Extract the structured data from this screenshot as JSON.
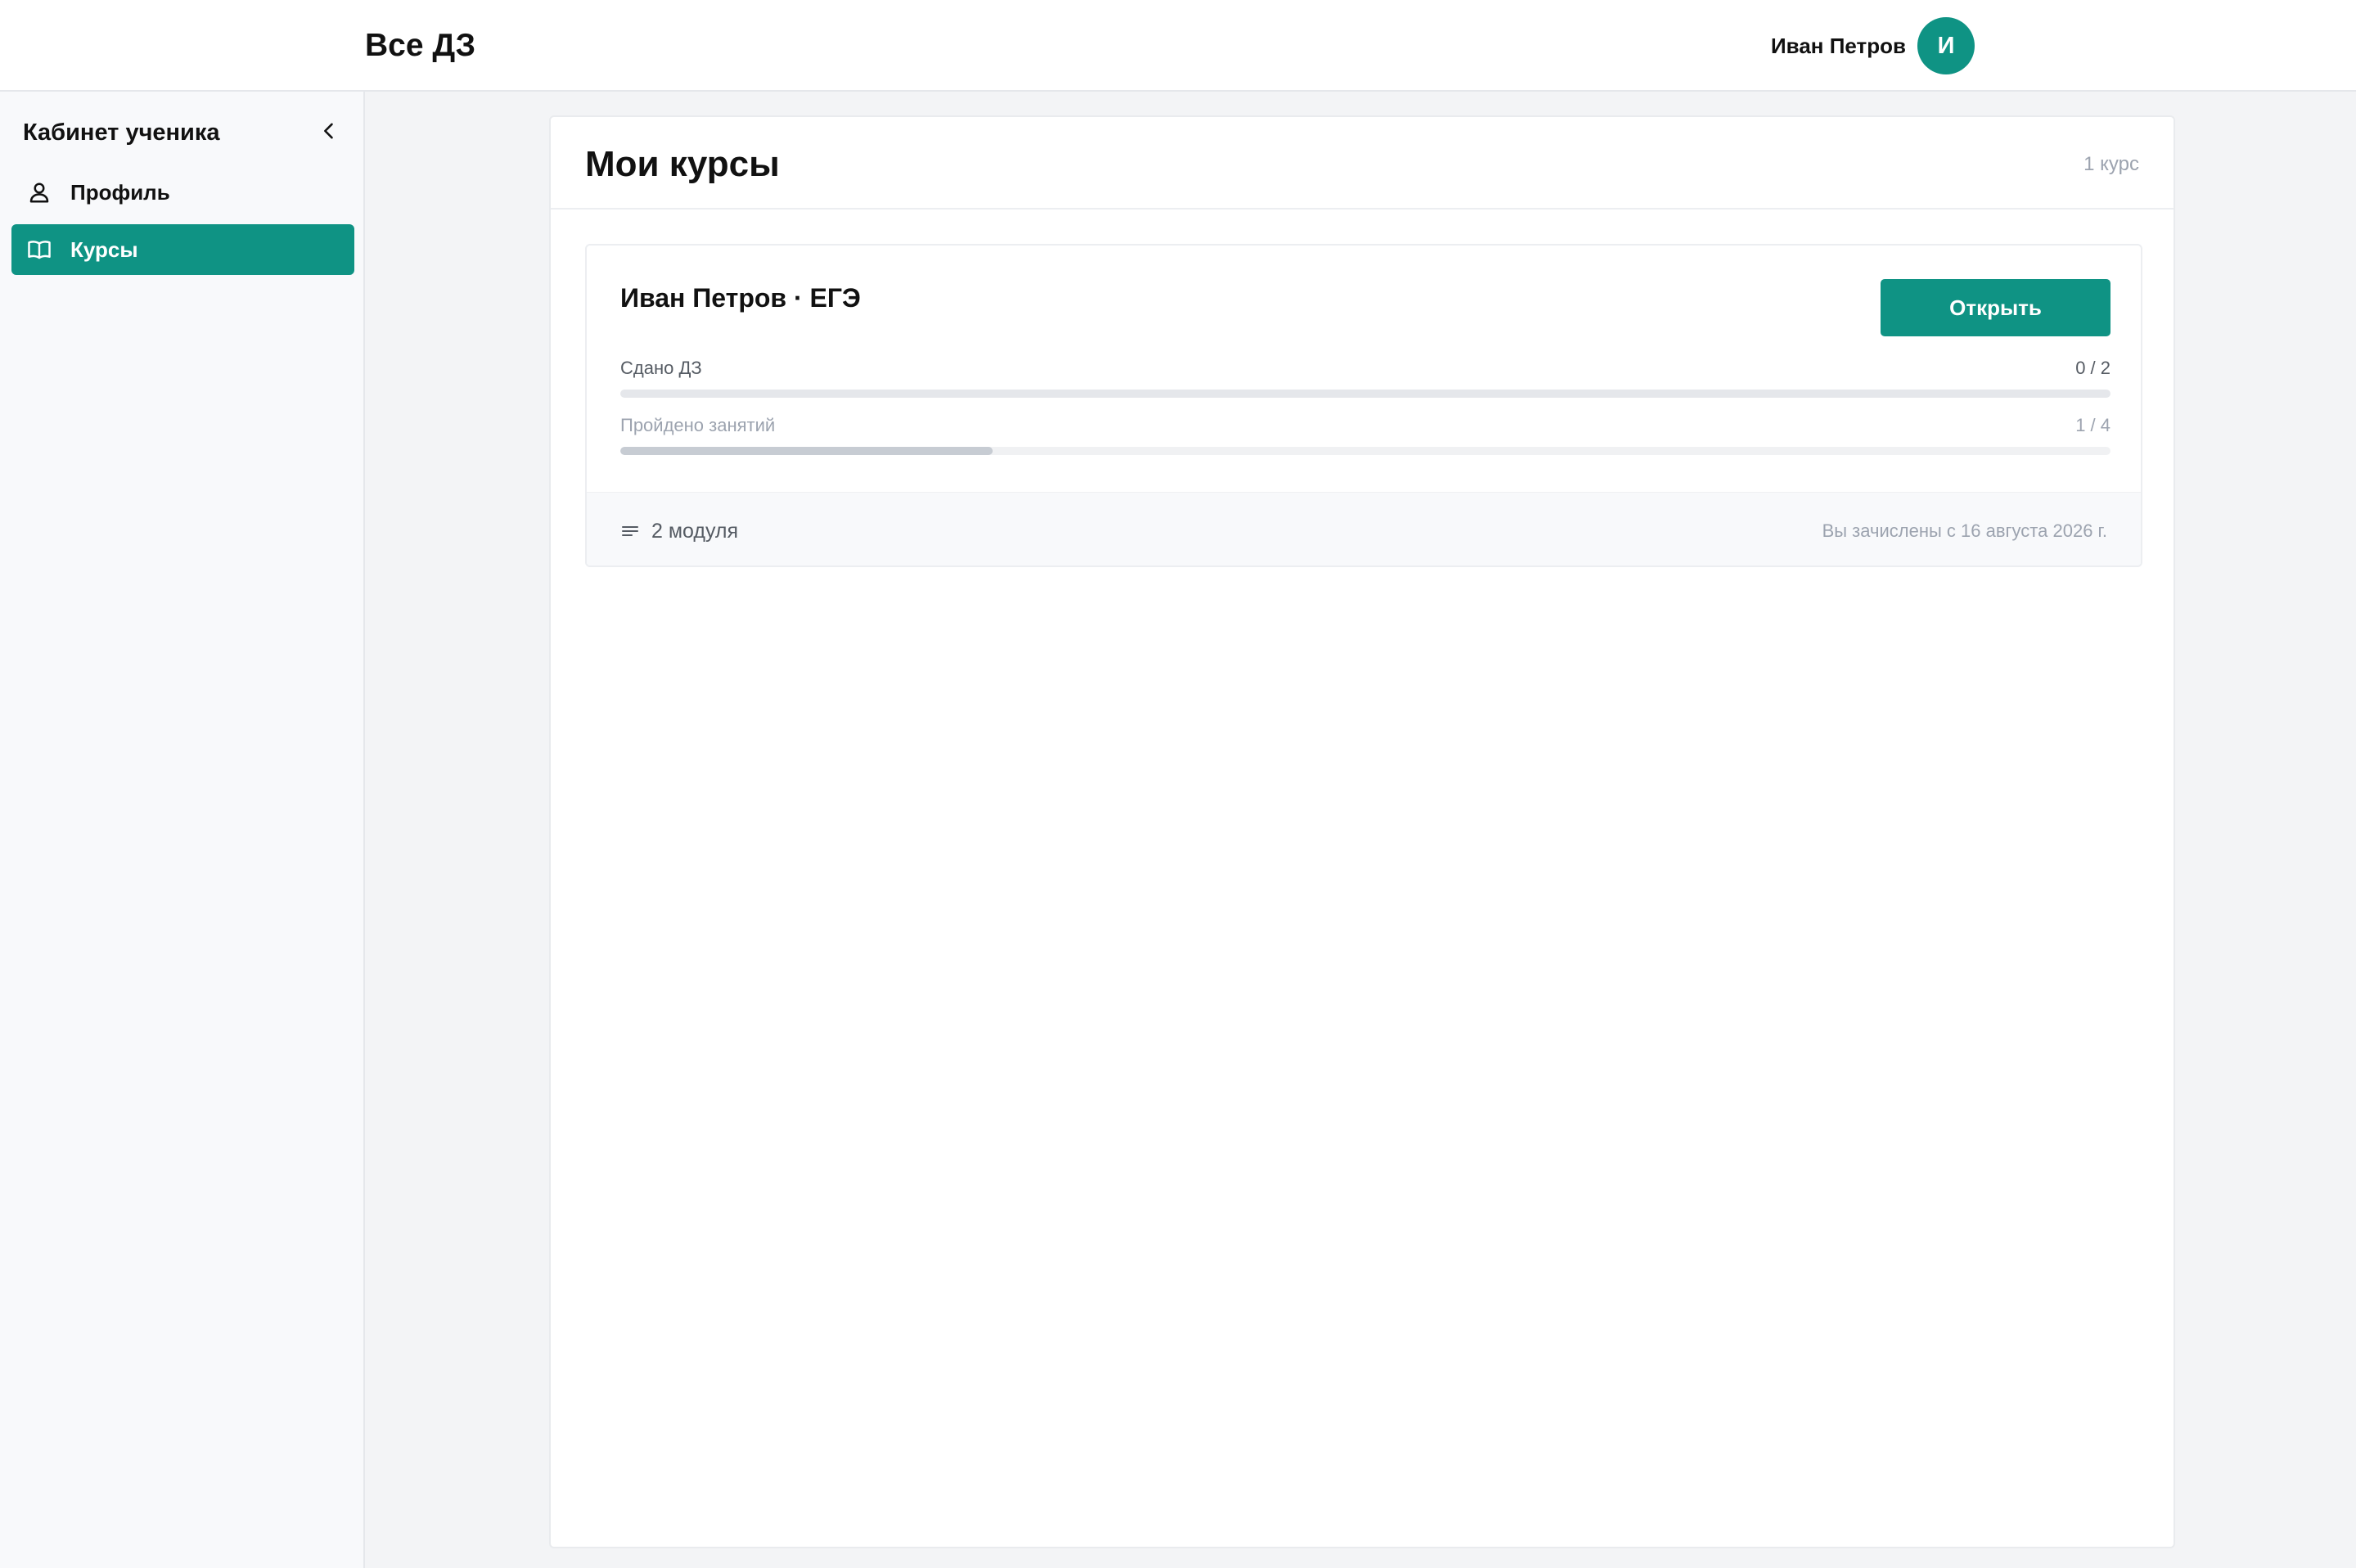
{
  "header": {
    "title": "Все ДЗ",
    "user_name": "Иван Петров",
    "avatar_initial": "И"
  },
  "sidebar": {
    "title": "Кабинет ученика",
    "items": [
      {
        "label": "Профиль",
        "icon": "user-icon",
        "active": false
      },
      {
        "label": "Курсы",
        "icon": "book-open-icon",
        "active": true
      }
    ]
  },
  "main": {
    "title": "Мои курсы",
    "course_count": "1 курс",
    "courses": [
      {
        "title": "Иван Петров · ЕГЭ",
        "open_label": "Открыть",
        "homework": {
          "label": "Сдано ДЗ",
          "value": "0 / 2",
          "done": 0,
          "total": 2
        },
        "lessons": {
          "label": "Пройдено занятий",
          "value": "1 / 4",
          "done": 1,
          "total": 4
        },
        "modules": "2 модуля",
        "enrolled": "Вы зачислены с 16 августа 2026 г."
      }
    ]
  },
  "colors": {
    "accent": "#0f9384",
    "background": "#f3f4f6",
    "muted_text": "#9ca3af"
  }
}
